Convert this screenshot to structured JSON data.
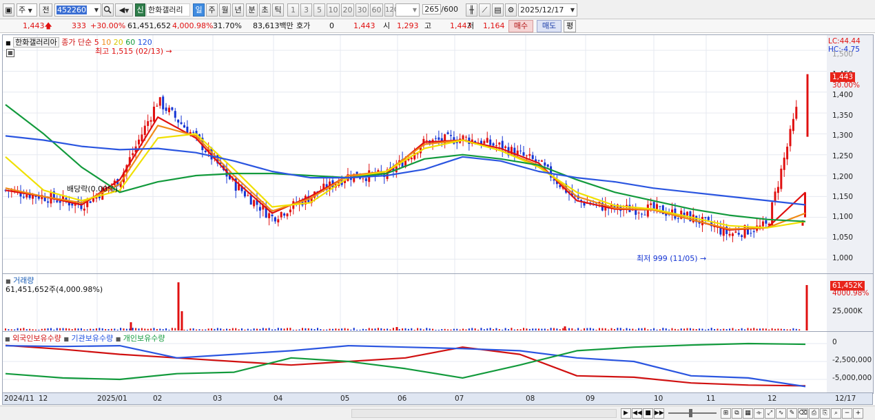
{
  "toolbar": {
    "period_label": "주",
    "prev_label": "전",
    "stock_code": "452260",
    "new_badge": "신",
    "stock_name": "한화갤러리",
    "timeframes": [
      "일",
      "주",
      "월",
      "년",
      "분",
      "초",
      "틱"
    ],
    "intervals": [
      "1",
      "3",
      "5",
      "10",
      "20",
      "30",
      "60",
      "120"
    ],
    "bar_count": "265",
    "bar_total": "/600",
    "date": "2025/12/17"
  },
  "quote": {
    "price": "1,443",
    "change": "333",
    "change_pct": "+30.00%",
    "volume": "61,451,652",
    "volume_ratio": "4,000.98%",
    "turnover": "31.70%",
    "amount": "83,613백만",
    "bid_label": "호가",
    "bid_value": "0",
    "bid_price": "1,443",
    "open_label": "시",
    "open_value": "1,293",
    "high_label": "고",
    "high_value": "1,443",
    "low_label": "저",
    "low_value": "1,164",
    "buy_label": "매수",
    "sell_label": "매도",
    "avg_label": "평"
  },
  "price_panel": {
    "stock_label": "한화갤러리아",
    "legend_prefix": "종가 단순",
    "ma_labels": [
      {
        "label": "5",
        "color": "#e01010"
      },
      {
        "label": "10",
        "color": "#f08a16"
      },
      {
        "label": "20",
        "color": "#e5d800"
      },
      {
        "label": "60",
        "color": "#129a3c"
      },
      {
        "label": "120",
        "color": "#1e4fe0"
      }
    ],
    "high_annotation": "최고 1,515 (02/13)",
    "low_annotation": "최저 999 (11/05)",
    "dividend_annotation": "배당락(0.00%)",
    "lc_label": "LC:44.44",
    "hc_label": "HC:-4.75",
    "yticks": [
      "1,500",
      "1,450",
      "1,400",
      "1,350",
      "1,300",
      "1,250",
      "1,200",
      "1,150",
      "1,100",
      "1,050",
      "1,000"
    ],
    "price_tag": "1,443",
    "pct_tag": "30.00%"
  },
  "volume_panel": {
    "title": "거래량",
    "value_label": "61,451,652주(4,000.98%)",
    "tag": "61,452K",
    "pct": "4000.98%",
    "tick": "25,000K"
  },
  "holdings_panel": {
    "legend": [
      {
        "label": "외국인보유수량",
        "color": "#d01010"
      },
      {
        "label": "기관보유수량",
        "color": "#1e4fe0"
      },
      {
        "label": "개인보유수량",
        "color": "#129a3c"
      }
    ],
    "yticks": [
      "0",
      "-2,500,000",
      "-5,000,000"
    ]
  },
  "xaxis": {
    "labels": [
      "2024/11",
      "12",
      "2025/01",
      "02",
      "03",
      "04",
      "05",
      "06",
      "07",
      "08",
      "09",
      "10",
      "11",
      "12"
    ],
    "right_label": "12/17"
  },
  "chart_data": {
    "type": "candlestick",
    "title": "한화갤러리아",
    "ylim": [
      975,
      1520
    ],
    "months": [
      "2024/11",
      "12",
      "2025/01",
      "02",
      "03",
      "04",
      "05",
      "06",
      "07",
      "08",
      "09",
      "10",
      "11",
      "12"
    ],
    "close_approx": [
      1165,
      1150,
      1130,
      1190,
      1380,
      1290,
      1180,
      1100,
      1150,
      1200,
      1200,
      1280,
      1290,
      1270,
      1230,
      1140,
      1120,
      1120,
      1100,
      1060,
      1080,
      1443
    ],
    "series": [
      {
        "name": "5",
        "values": [
          1165,
          1150,
          1130,
          1190,
          1340,
          1290,
          1190,
          1110,
          1150,
          1200,
          1205,
          1280,
          1285,
          1265,
          1230,
          1140,
          1120,
          1118,
          1095,
          1070,
          1075,
          1160
        ]
      },
      {
        "name": "10",
        "values": [
          1170,
          1150,
          1135,
          1180,
          1320,
          1295,
          1200,
          1115,
          1145,
          1200,
          1210,
          1275,
          1285,
          1260,
          1225,
          1150,
          1122,
          1118,
          1095,
          1072,
          1075,
          1110
        ]
      },
      {
        "name": "20",
        "values": [
          1245,
          1165,
          1140,
          1165,
          1290,
          1300,
          1215,
          1125,
          1135,
          1195,
          1210,
          1265,
          1285,
          1260,
          1220,
          1160,
          1128,
          1120,
          1100,
          1080,
          1075,
          1090
        ]
      },
      {
        "name": "60",
        "values": [
          1370,
          1300,
          1220,
          1160,
          1185,
          1200,
          1205,
          1205,
          1200,
          1195,
          1205,
          1240,
          1250,
          1240,
          1225,
          1190,
          1160,
          1140,
          1120,
          1105,
          1095,
          1090
        ]
      },
      {
        "name": "120",
        "values": [
          1295,
          1285,
          1270,
          1262,
          1265,
          1255,
          1235,
          1210,
          1195,
          1195,
          1200,
          1215,
          1245,
          1235,
          1210,
          1195,
          1185,
          1170,
          1160,
          1150,
          1140,
          1130
        ]
      }
    ],
    "volume": {
      "last": "61,451,652",
      "unit": "주"
    },
    "holdings": {
      "series": [
        {
          "name": "외국인보유수량",
          "values": [
            -250000,
            -800000,
            -1500000,
            -2000000,
            -2500000,
            -3000000,
            -2500000,
            -2000000,
            -500000,
            -1500000,
            -4500000,
            -4700000,
            -5500000,
            -5800000,
            -5900000
          ]
        },
        {
          "name": "기관보유수량",
          "values": [
            -300000,
            -400000,
            -300000,
            -2000000,
            -1500000,
            -1000000,
            -300000,
            -500000,
            -700000,
            -1000000,
            -2000000,
            -2500000,
            -4500000,
            -4800000,
            -6000000
          ]
        },
        {
          "name": "개인보유수량",
          "values": [
            -4200000,
            -4800000,
            -5000000,
            -4200000,
            -4000000,
            -2000000,
            -2500000,
            -3500000,
            -4800000,
            -3000000,
            -1000000,
            -500000,
            -200000,
            0,
            -100000
          ]
        }
      ]
    }
  }
}
